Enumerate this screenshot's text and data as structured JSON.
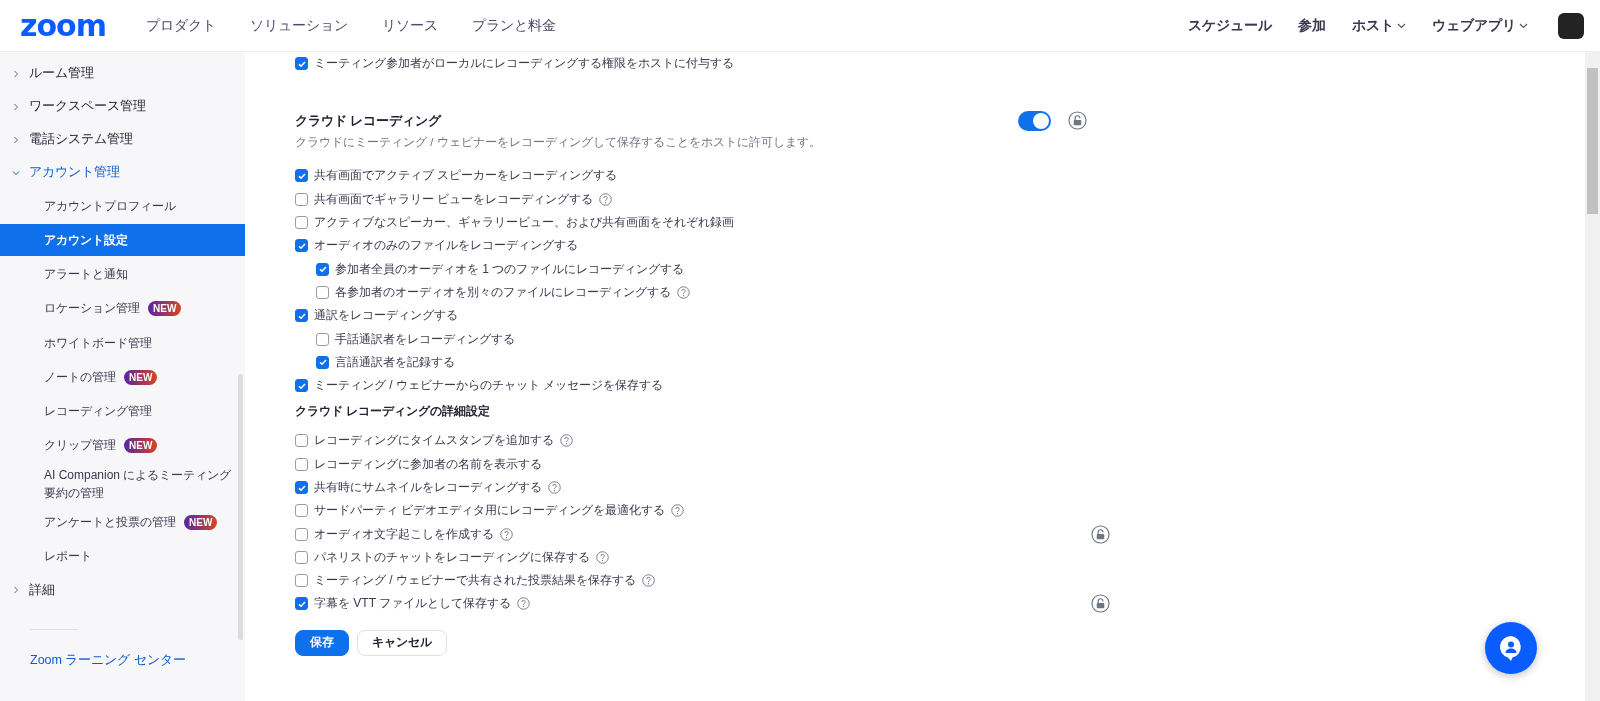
{
  "header": {
    "logo": "zoom",
    "nav_left": [
      {
        "label": "プロダクト"
      },
      {
        "label": "ソリューション"
      },
      {
        "label": "リソース"
      },
      {
        "label": "プランと料金"
      }
    ],
    "nav_right": [
      {
        "label": "スケジュール",
        "dropdown": false
      },
      {
        "label": "参加",
        "dropdown": false
      },
      {
        "label": "ホスト",
        "dropdown": true
      },
      {
        "label": "ウェブアプリ",
        "dropdown": true
      }
    ]
  },
  "sidebar": {
    "items": [
      {
        "label": "ルーム管理",
        "expanded": false
      },
      {
        "label": "ワークスペース管理",
        "expanded": false
      },
      {
        "label": "電話システム管理",
        "expanded": false
      },
      {
        "label": "アカウント管理",
        "expanded": true,
        "children": [
          {
            "label": "アカウントプロフィール",
            "selected": false
          },
          {
            "label": "アカウント設定",
            "selected": true
          },
          {
            "label": "アラートと通知",
            "selected": false
          },
          {
            "label": "ロケーション管理",
            "selected": false,
            "badge": "NEW"
          },
          {
            "label": "ホワイトボード管理",
            "selected": false
          },
          {
            "label": "ノートの管理",
            "selected": false,
            "badge": "NEW"
          },
          {
            "label": "レコーディング管理",
            "selected": false
          },
          {
            "label": "クリップ管理",
            "selected": false,
            "badge": "NEW"
          },
          {
            "label": "AI Companion によるミーティング要約の管理",
            "selected": false
          },
          {
            "label": "アンケートと投票の管理",
            "selected": false,
            "badge": "NEW"
          },
          {
            "label": "レポート",
            "selected": false
          }
        ]
      },
      {
        "label": "詳細",
        "expanded": false
      }
    ],
    "footer_link": "Zoom ラーニング センター"
  },
  "content": {
    "top_option": {
      "label": "ミーティング参加者がローカルにレコーディングする権限をホストに付与する",
      "checked": true
    },
    "section": {
      "title": "クラウド レコーディング",
      "enabled": true,
      "has_lock": true,
      "description": "クラウドにミーティング / ウェビナーをレコーディングして保存することをホストに許可します。",
      "options": [
        {
          "label": "共有画面でアクティブ スピーカーをレコーディングする",
          "checked": true,
          "help": false
        },
        {
          "label": "共有画面でギャラリー ビューをレコーディングする",
          "checked": false,
          "help": true
        },
        {
          "label": "アクティブなスピーカー、ギャラリービュー、および共有画面をそれぞれ録画",
          "checked": false,
          "help": false
        },
        {
          "label": "オーディオのみのファイルをレコーディングする",
          "checked": true,
          "help": false,
          "children": [
            {
              "label": "参加者全員のオーディオを 1 つのファイルにレコーディングする",
              "checked": true,
              "help": false
            },
            {
              "label": "各参加者のオーディオを別々のファイルにレコーディングする",
              "checked": false,
              "help": true
            }
          ]
        },
        {
          "label": "通訳をレコーディングする",
          "checked": true,
          "help": false,
          "children": [
            {
              "label": "手話通訳者をレコーディングする",
              "checked": false,
              "help": false
            },
            {
              "label": "言語通訳者を記録する",
              "checked": true,
              "help": false
            }
          ]
        },
        {
          "label": "ミーティング / ウェビナーからのチャット メッセージを保存する",
          "checked": true,
          "help": false
        }
      ],
      "advanced_title": "クラウド レコーディングの詳細設定",
      "advanced_options": [
        {
          "label": "レコーディングにタイムスタンプを追加する",
          "checked": false,
          "help": true,
          "has_lock": false
        },
        {
          "label": "レコーディングに参加者の名前を表示する",
          "checked": false,
          "help": false,
          "has_lock": false
        },
        {
          "label": "共有時にサムネイルをレコーディングする",
          "checked": true,
          "help": true,
          "has_lock": false
        },
        {
          "label": "サードパーティ ビデオエディタ用にレコーディングを最適化する",
          "checked": false,
          "help": true,
          "has_lock": false
        },
        {
          "label": "オーディオ文字起こしを作成する",
          "checked": false,
          "help": true,
          "has_lock": true
        },
        {
          "label": "パネリストのチャットをレコーディングに保存する",
          "checked": false,
          "help": true,
          "has_lock": false
        },
        {
          "label": "ミーティング / ウェビナーで共有された投票結果を保存する",
          "checked": false,
          "help": true,
          "has_lock": false
        },
        {
          "label": "字幕を VTT ファイルとして保存する",
          "checked": true,
          "help": true,
          "has_lock": true
        }
      ],
      "buttons": [
        {
          "label": "保存",
          "kind": "primary"
        },
        {
          "label": "キャンセル",
          "kind": "secondary"
        }
      ]
    }
  }
}
